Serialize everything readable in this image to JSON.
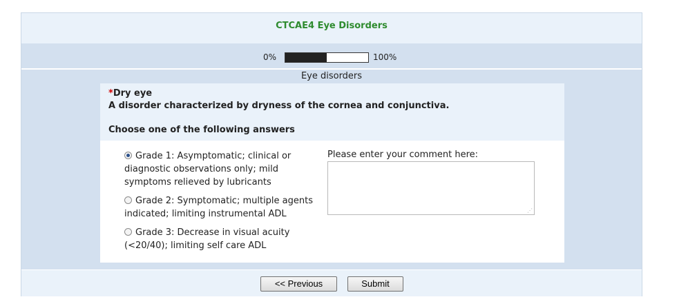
{
  "survey": {
    "title": "CTCAE4 Eye Disorders"
  },
  "progress": {
    "start_label": "0%",
    "end_label": "100%",
    "value_percent": 50
  },
  "section": {
    "header": "Eye disorders"
  },
  "question": {
    "mandatory_marker": "*",
    "title": "Dry eye",
    "description": "A disorder characterized by dryness of the cornea and conjunctiva.",
    "help": "Choose one of the following answers",
    "answers": [
      {
        "label": "Grade 1: Asymptomatic; clinical or diagnostic observations only; mild symptoms relieved by lubricants",
        "checked": true
      },
      {
        "label": "Grade 2: Symptomatic; multiple agents indicated; limiting instrumental ADL",
        "checked": false
      },
      {
        "label": "Grade 3: Decrease in visual acuity (<20/40); limiting self care ADL",
        "checked": false
      }
    ],
    "comment_label": "Please enter your comment here:",
    "comment_value": ""
  },
  "navigation": {
    "previous_label": "<< Previous",
    "submit_label": "Submit"
  },
  "colors": {
    "title_green": "#2e8b2e",
    "panel_blue": "#d3e0ef",
    "light_blue": "#eaf2fa",
    "mandatory_red": "#d10000"
  },
  "icons": {
    "textarea_resize": "resize-grip-icon"
  }
}
